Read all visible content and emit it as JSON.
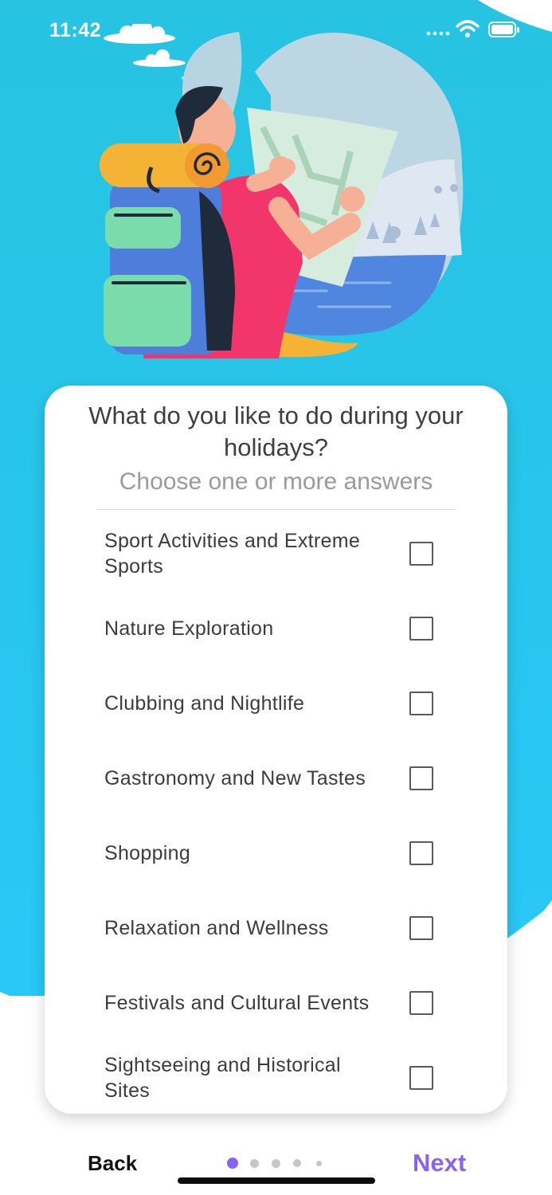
{
  "status_bar": {
    "time": "11:42",
    "icons": [
      "signal-icon",
      "wifi-icon",
      "battery-icon"
    ]
  },
  "illustration": {
    "icon": "traveler-with-backpack-and-map-illustration"
  },
  "card": {
    "question": "What do you like to do during your holidays?",
    "hint": "Choose one or more answers",
    "options": [
      {
        "label": "Sport Activities and Extreme Sports",
        "checked": false
      },
      {
        "label": "Nature Exploration",
        "checked": false
      },
      {
        "label": "Clubbing and Nightlife",
        "checked": false
      },
      {
        "label": "Gastronomy and New Tastes",
        "checked": false
      },
      {
        "label": "Shopping",
        "checked": false
      },
      {
        "label": "Relaxation and Wellness",
        "checked": false
      },
      {
        "label": "Festivals and Cultural Events",
        "checked": false
      },
      {
        "label": "Sightseeing and Historical Sites",
        "checked": false
      }
    ]
  },
  "navigation": {
    "back_label": "Back",
    "next_label": "Next",
    "page_count": 5,
    "current_page": 1
  },
  "colors": {
    "background_top": "#27c3e1",
    "background_bottom": "#29c8f7",
    "accent": "#8a63ef",
    "card": "#ffffff"
  }
}
